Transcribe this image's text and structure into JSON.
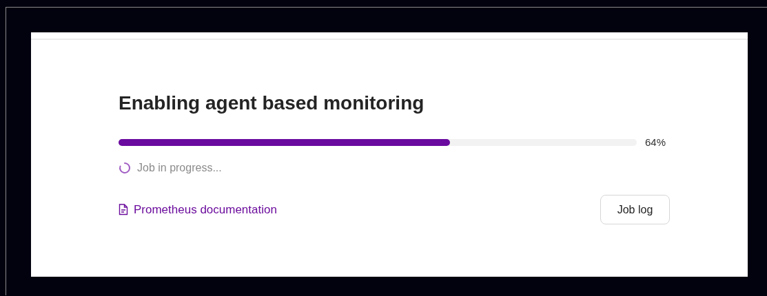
{
  "title": "Enabling agent based monitoring",
  "progress": {
    "level": 0.64,
    "reading": "64%"
  },
  "status": {
    "text": "Job in progress..."
  },
  "link": {
    "label": "Prometheus documentation"
  },
  "buttons": [
    {
      "label": "Job log"
    }
  ]
}
